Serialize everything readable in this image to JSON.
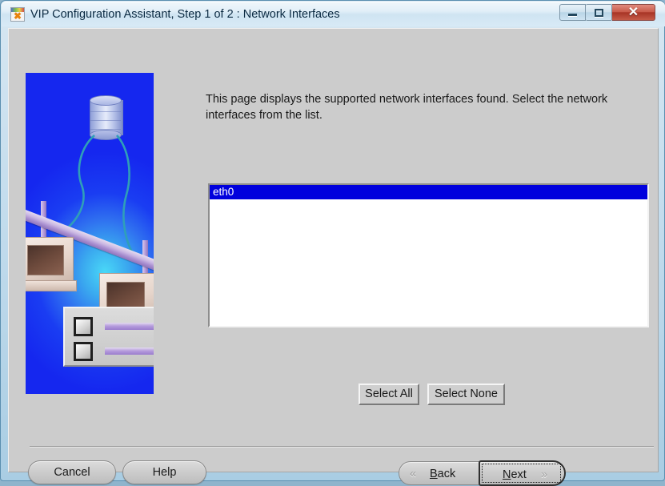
{
  "window": {
    "title": "VIP Configuration Assistant, Step 1 of 2 : Network Interfaces",
    "icon": "app-window-icon",
    "controls": {
      "minimize_label": "–",
      "maximize_label": "□",
      "close_label": "✕"
    }
  },
  "main": {
    "description": "This page displays the supported network interfaces found. Select the network interfaces from the list.",
    "artwork_alt": "network-diagram-illustration"
  },
  "interface_list": {
    "items": [
      {
        "label": "eth0",
        "selected": true
      }
    ]
  },
  "selection_buttons": {
    "select_all": "Select All",
    "select_none": "Select None"
  },
  "footer": {
    "cancel": "Cancel",
    "help": "Help",
    "back": {
      "prefix": "B",
      "rest": "ack",
      "chevron": "«",
      "enabled": false
    },
    "next": {
      "prefix": "N",
      "rest": "ext",
      "chevron": "»",
      "focused": true
    }
  },
  "colors": {
    "selection_blue": "#0000dd",
    "dialog_gray": "#cccccc",
    "artwork_blue": "#1527ef",
    "close_red": "#c85a49"
  }
}
